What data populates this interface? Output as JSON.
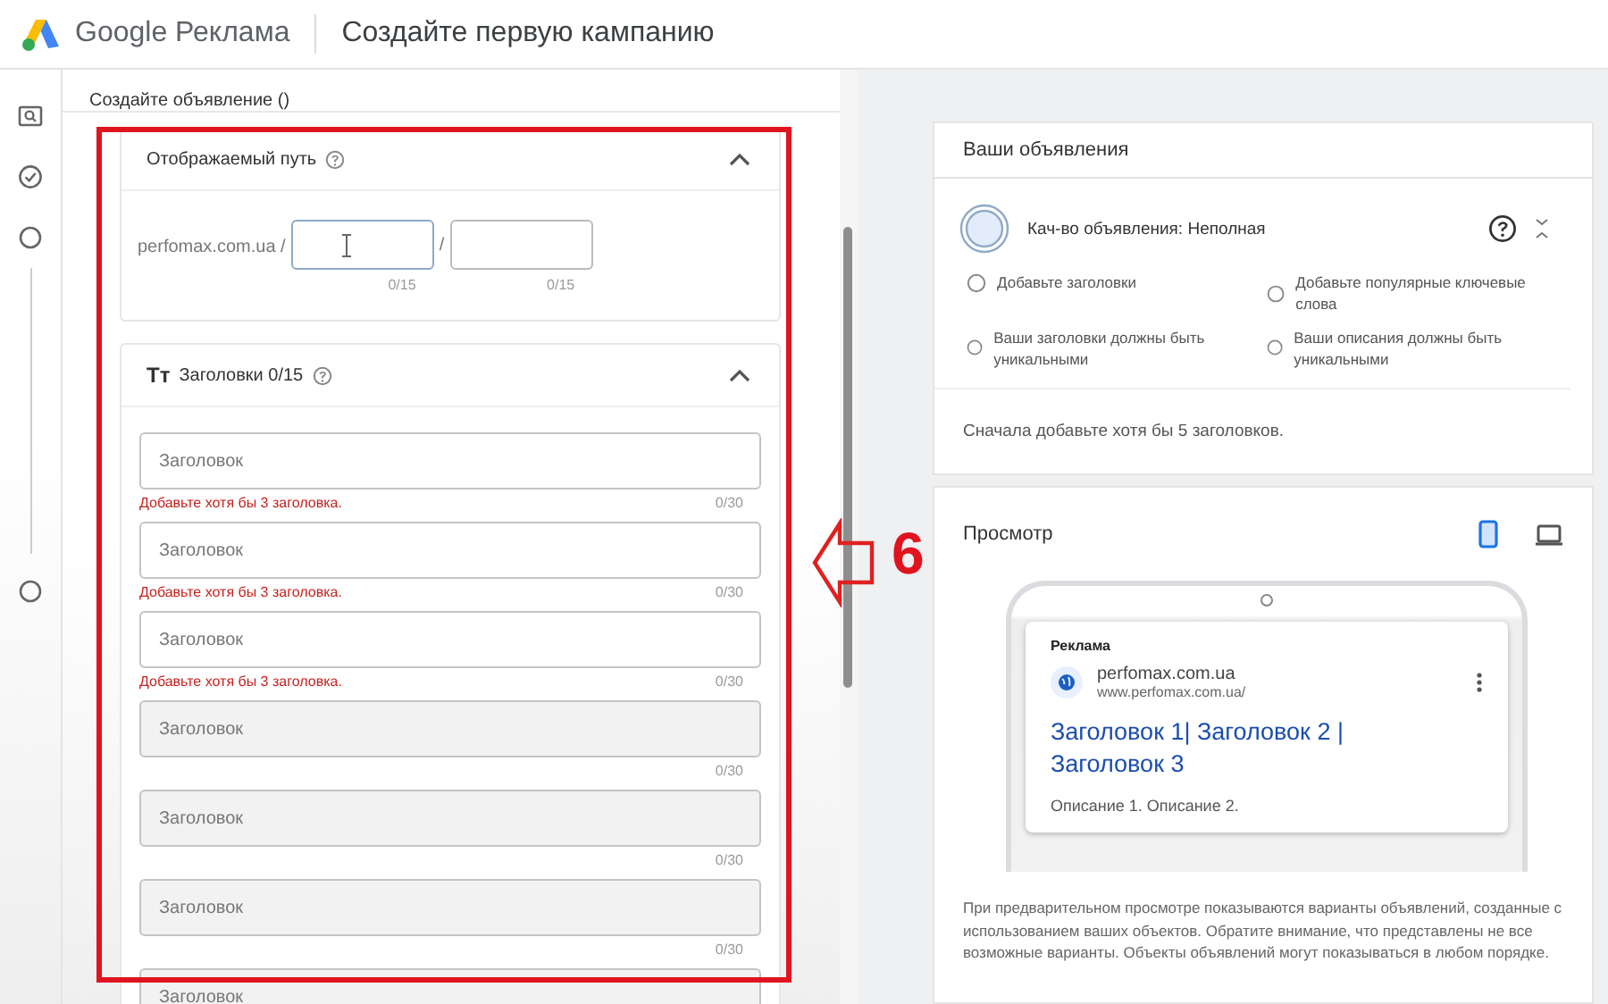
{
  "header": {
    "product": "Google Реклама",
    "title": "Создайте первую кампанию"
  },
  "rail": {
    "steps": [
      {
        "kind": "ad"
      },
      {
        "kind": "check"
      },
      {
        "kind": "circle"
      },
      {
        "kind": "circle"
      }
    ]
  },
  "editor": {
    "title": "Создайте объявление ()",
    "display_path": {
      "title": "Отображаемый путь",
      "expanded": true,
      "domain": "perfomax.com.ua /",
      "separator": "/",
      "fields": [
        {
          "counter": "0/15",
          "focused": true
        },
        {
          "counter": "0/15",
          "focused": false
        }
      ]
    },
    "headlines": {
      "icon": "Tт",
      "title": "Заголовки 0/15",
      "expanded": true,
      "fields": [
        {
          "placeholder": "Заголовок",
          "error": "Добавьте хотя бы 3 заголовка.",
          "counter": "0/30"
        },
        {
          "placeholder": "Заголовок",
          "error": "Добавьте хотя бы 3 заголовка.",
          "counter": "0/30"
        },
        {
          "placeholder": "Заголовок",
          "error": "Добавьте хотя бы 3 заголовка.",
          "counter": "0/30"
        },
        {
          "placeholder": "Заголовок",
          "counter": "0/30"
        },
        {
          "placeholder": "Заголовок",
          "counter": "0/30"
        },
        {
          "placeholder": "Заголовок",
          "counter": "0/30"
        },
        {
          "placeholder": "Заголовок"
        }
      ]
    }
  },
  "ads": {
    "title": "Ваши объявления",
    "quality": "Кач-во объявления: Неполная",
    "checklist": [
      {
        "text": "Добавьте заголовки",
        "done": false
      },
      {
        "text": "Добавьте популярные ключевые слова",
        "done": false
      },
      {
        "text": "Ваши заголовки должны быть уникальными",
        "done": false
      },
      {
        "text": "Ваши описания должны быть уникальными",
        "done": false
      }
    ],
    "hint": "Сначала добавьте хотя бы 5 заголовков."
  },
  "preview": {
    "title": "Просмотр",
    "devices": [
      {
        "kind": "mobile",
        "selected": true
      },
      {
        "kind": "desktop",
        "selected": false
      }
    ],
    "ad": {
      "label": "Реклама",
      "site": "perfomax.com.ua",
      "url": "www.perfomax.com.ua/",
      "headline": "Заголовок 1| Заголовок 2 | Заголовок 3",
      "description": "Описание 1. Описание 2."
    },
    "note": "При предварительном просмотре показываются варианты объявлений, созданные с использованием ваших объектов. Обратите внимание, что представлены не все возможные варианты. Объекты объявлений могут показываться в любом порядке."
  },
  "annotation": {
    "number": "6"
  }
}
